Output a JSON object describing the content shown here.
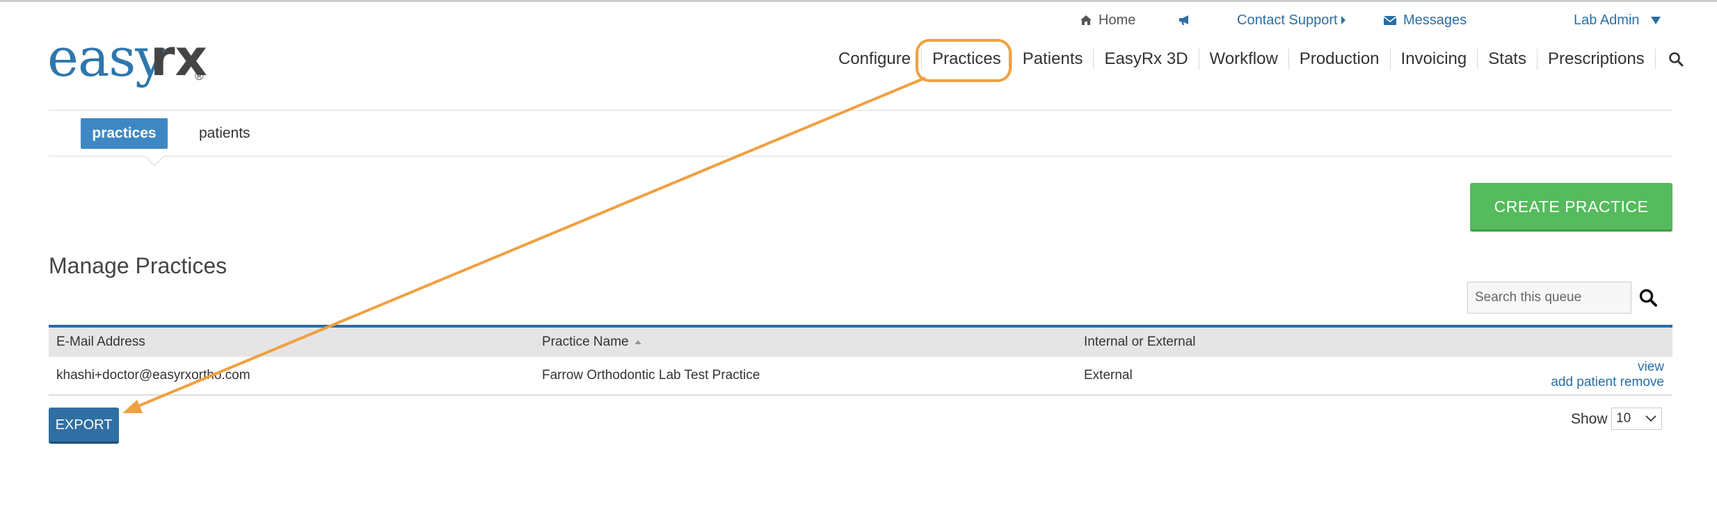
{
  "utility": {
    "home": "Home",
    "support": "Contact Support",
    "messages": "Messages",
    "account": "Lab Admin"
  },
  "logo": {
    "part1": "easy",
    "part2": "rx",
    "reg": "®"
  },
  "nav": {
    "items": [
      "Configure",
      "Practices",
      "Patients",
      "EasyRx 3D",
      "Workflow",
      "Production",
      "Invoicing",
      "Stats",
      "Prescriptions"
    ],
    "highlighted": "Practices"
  },
  "subtabs": {
    "active": "practices",
    "other": "patients"
  },
  "create_label": "CREATE PRACTICE",
  "page_title": "Manage Practices",
  "search": {
    "placeholder": "Search this queue"
  },
  "table": {
    "columns": [
      "E-Mail Address",
      "Practice Name",
      "Internal or External"
    ],
    "rows": [
      {
        "email": "khashi+doctor@easyrxortho.com",
        "practice": "Farrow Orthodontic Lab Test Practice",
        "type": "External",
        "actions": {
          "view": "view",
          "add_patient": "add patient",
          "remove": "remove"
        }
      }
    ]
  },
  "export_label": "EXPORT",
  "pagination": {
    "show_label": "Show",
    "page_size": "10"
  },
  "colors": {
    "accent_blue": "#2a6ea6",
    "tab_blue": "#3d88c4",
    "create_green": "#55bb5d",
    "annotation_orange": "#f0a040"
  }
}
